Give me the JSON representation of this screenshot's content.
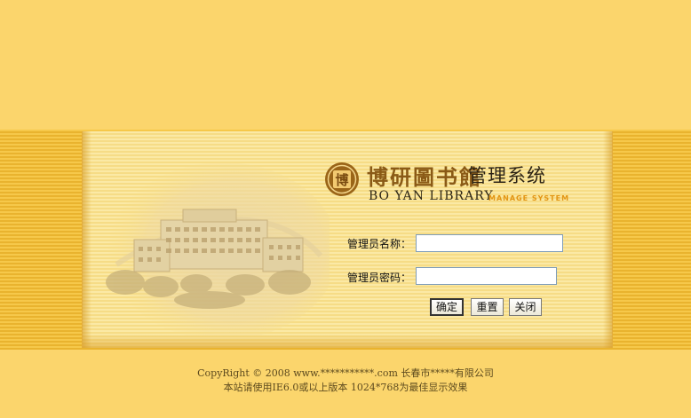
{
  "logo": {
    "seal_char": "博",
    "name_cn": "博研圖书館",
    "system_cn": "管理系统",
    "name_en": "BO YAN LIBRARY",
    "system_en": "MANAGE SYSTEM"
  },
  "form": {
    "username_label": "管理员名称：",
    "username_value": "",
    "password_label": "管理员密码：",
    "password_value": "",
    "buttons": {
      "confirm": "确定",
      "reset": "重置",
      "close": "关闭"
    }
  },
  "footer": {
    "copyright": "CopyRight © 2008 www.***********.com 长春市*****有限公司",
    "browser_note": "本站请使用IE6.0或以上版本  1024*768为最佳显示效果"
  },
  "colors": {
    "background": "#fbd56c",
    "panel": "#fbe9a5",
    "logo_brown": "#8a5a16",
    "accent_orange": "#e39514"
  }
}
